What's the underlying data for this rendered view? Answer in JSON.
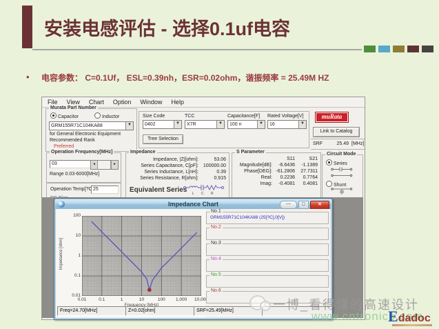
{
  "slide": {
    "title": "安装电感评估 - 选择0.1uf电容",
    "bullet": "电容参数： C=0.1Uf， ESL=0.39nh，ESR=0.02ohm，谐振频率 = 25.49M HZ",
    "bullet_marker": "•",
    "accent_colors": [
      "#4e8f3c",
      "#58aac6",
      "#8f7d36",
      "#5d3434",
      "#474341"
    ],
    "title_color": "#6b3235"
  },
  "app": {
    "menu": [
      "File",
      "View",
      "Chart",
      "Option",
      "Window",
      "Help"
    ],
    "part_group": {
      "label": "Murata Part Number",
      "cap_radio": "Capacitor",
      "ind_radio": "Inductor",
      "part": "GRM155R71C104KA88",
      "desc1": "for General Electronic Equipment",
      "desc2": "Recommended Rank",
      "rank": "Preferred",
      "rank_color": "#c14038"
    },
    "sel_group": {
      "size_label": "Size Code",
      "size_value": "0402",
      "tcc_label": "TCC",
      "tcc_value": "X7R",
      "cap_label": "Capacitance[F]",
      "cap_value": "100 n",
      "volt_label": "Rated Voltage[V]",
      "volt_value": "16",
      "tree_button": "Tree Selection"
    },
    "murata": {
      "logo": "muRata",
      "catalog": "Link to Catalog",
      "srf_label": "SRF",
      "srf_value": "25.49",
      "srf_unit": "[MHz]"
    },
    "opfreq": {
      "label": "Operation Frequency[MHz]",
      "value": "03",
      "range": "Range 0.03-6000[MHz]"
    },
    "optemp": {
      "label": "Operation Temp[?C]",
      "value": "25",
      "dc_clipped": "DC Bias"
    },
    "impedance": {
      "label": "Impedance",
      "rows": [
        {
          "name": "Impedance, |Z|[ohm]:",
          "value": "53.06"
        },
        {
          "name": "Series Capacitance, C[pF]:",
          "value": "100000.00"
        },
        {
          "name": "Series Inductance, L[nH]:",
          "value": "0.39"
        },
        {
          "name": "Series Resistance, R[ohm]:",
          "value": "0.915"
        }
      ],
      "equivalent": "Equivalent Series",
      "letters": [
        "L",
        "C",
        "R"
      ]
    },
    "sparam": {
      "label": "S Parameter",
      "col1": "S11",
      "col2": "S21",
      "rows": [
        {
          "name": "Magnitude[dB]:",
          "s11": "-6.6436",
          "s21": "-1.1389"
        },
        {
          "name": "Phase[DEG]:",
          "s11": "-61.2806",
          "s21": "27.7311"
        },
        {
          "name": "Real:",
          "s11": "0.2236",
          "s21": "0.7764"
        },
        {
          "name": "Imag:",
          "s11": "-0.4081",
          "s21": "0.4081"
        }
      ]
    },
    "cmode": {
      "label": "Circuit Mode",
      "series": "Series",
      "shunt": "Shunt"
    }
  },
  "chart_window": {
    "title": "Impedance Chart",
    "legend": [
      {
        "label": "No.1",
        "color": "#333333",
        "text": "GRM155R71C104KA88 (25[?C],0[V])"
      },
      {
        "label": "No.2",
        "color": "#c03a3a",
        "text": ""
      },
      {
        "label": "No.3",
        "color": "#333333",
        "text": ""
      },
      {
        "label": "No.4",
        "color": "#c050c0",
        "text": ""
      },
      {
        "label": "No.5",
        "color": "#3a9a3a",
        "text": ""
      },
      {
        "label": "No.6",
        "color": "#8a4a2a",
        "text": ""
      }
    ],
    "status": [
      "Freq=24.70[MHz]",
      "Z=0.02[ohm]",
      "SRF=25.49[MHz]"
    ]
  },
  "watermark": {
    "brand": "一博_看得懂的高速设计",
    "site": "www.cntronics.com",
    "logo_e": "E",
    "logo_rest": "dadoc"
  },
  "chart_data": {
    "type": "line",
    "title": "Impedance Chart",
    "xlabel": "Frequency [MHz]",
    "ylabel": "Impedance [ohm]",
    "x_scale": "log",
    "y_scale": "log",
    "xlim": [
      0.01,
      10000
    ],
    "ylim": [
      0.01,
      100
    ],
    "x_ticks": [
      "0.01",
      "0.1",
      "1",
      "10",
      "100",
      "1,000",
      "10,000"
    ],
    "y_ticks": [
      "100",
      "10",
      "1",
      "0.1",
      "0.01"
    ],
    "grid": true,
    "legend_position": "right",
    "series": [
      {
        "name": "GRM155R71C104KA88 (25[?C],0[V])",
        "color": "#5a52b8",
        "points": [
          [
            0.03,
            53.06
          ],
          [
            0.1,
            15.9
          ],
          [
            0.3,
            5.3
          ],
          [
            1,
            1.59
          ],
          [
            3,
            0.53
          ],
          [
            10,
            0.159
          ],
          [
            18,
            0.07
          ],
          [
            24.7,
            0.02
          ],
          [
            35,
            0.06
          ],
          [
            100,
            0.25
          ],
          [
            300,
            0.74
          ],
          [
            1000,
            2.45
          ],
          [
            3000,
            7.4
          ],
          [
            6000,
            14.7
          ]
        ]
      }
    ],
    "marker": {
      "x": 24.7,
      "y": 0.02,
      "color": "#b03030",
      "note": "SRF minimum"
    }
  }
}
